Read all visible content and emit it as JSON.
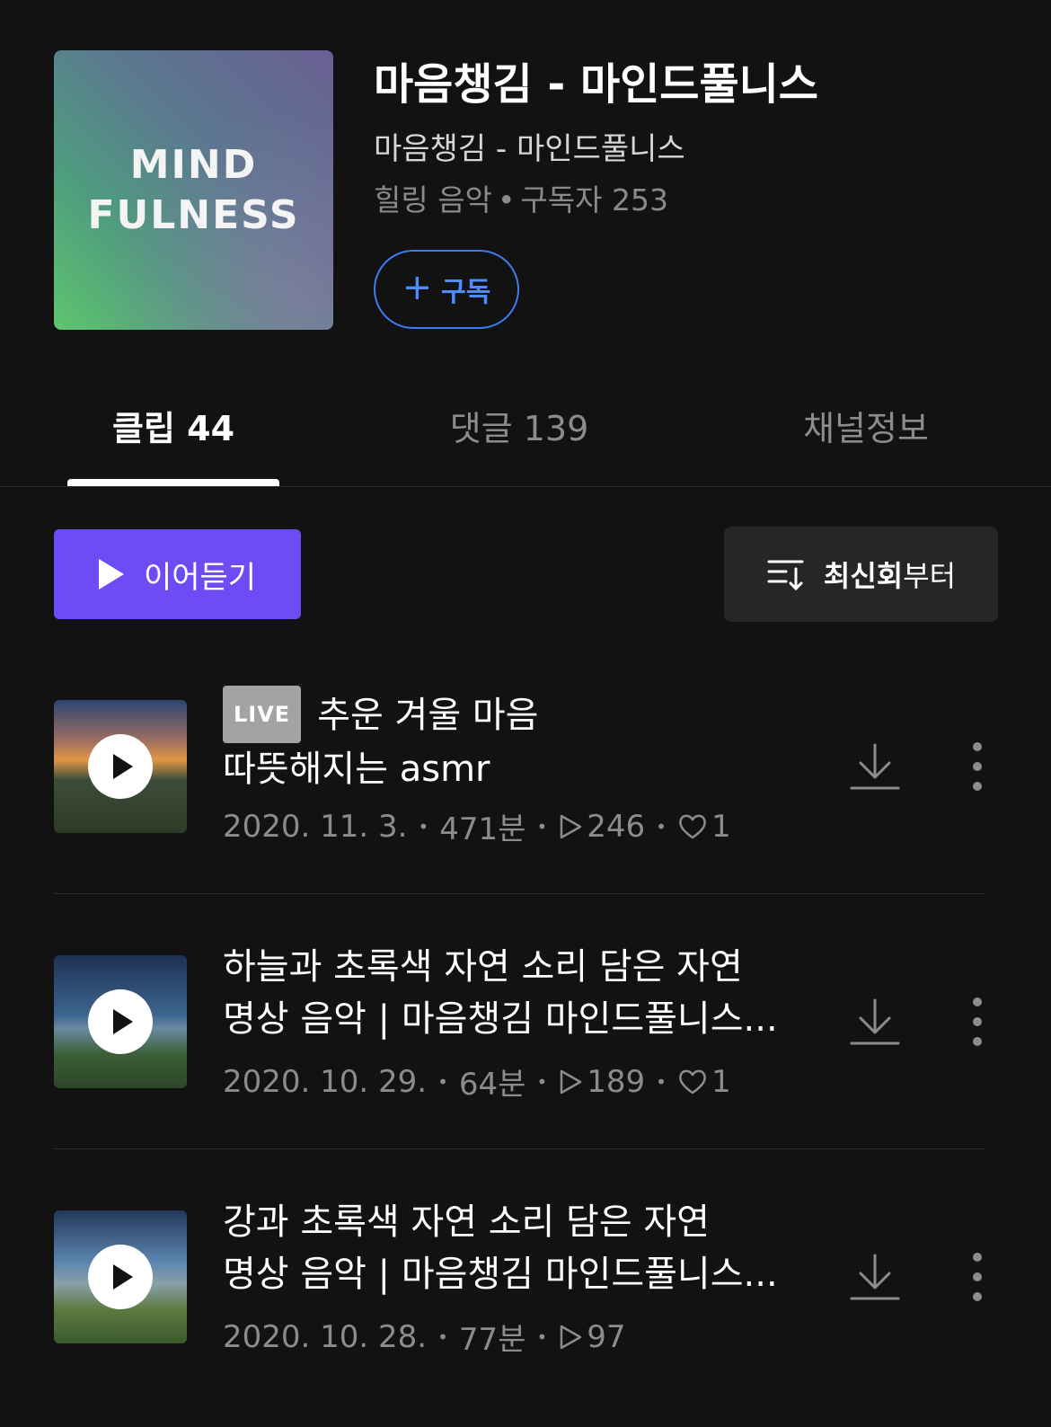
{
  "channel": {
    "cover_line1": "MIND",
    "cover_line2": "FULNESS",
    "title": "마음챙김 - 마인드풀니스",
    "subtitle": "마음챙김 - 마인드풀니스",
    "category": "힐링 음악",
    "subscribers": "구독자 253",
    "subscribe_label": "구독"
  },
  "tabs": [
    {
      "label": "클립 44",
      "active": true
    },
    {
      "label": "댓글 139",
      "active": false
    },
    {
      "label": "채널정보",
      "active": false
    }
  ],
  "controls": {
    "continue_label": "이어듣기",
    "sort_bold": "최신회",
    "sort_rest": "부터"
  },
  "clips": [
    {
      "live": "LIVE",
      "title_line1": "추운 겨울 마음",
      "title_line2": "따뜻해지는 asmr",
      "date": "2020. 11. 3.",
      "duration": "471분",
      "plays": "246",
      "likes": "1"
    },
    {
      "title_line1": "하늘과 초록색 자연 소리 담은 자연",
      "title_line2": "명상 음악 | 마음챙김 마인드풀니스...",
      "date": "2020. 10. 29.",
      "duration": "64분",
      "plays": "189",
      "likes": "1"
    },
    {
      "title_line1": "강과 초록색 자연 소리 담은 자연",
      "title_line2": "명상 음악 | 마음챙김 마인드풀니스...",
      "date": "2020. 10. 28.",
      "duration": "77분",
      "plays": "97"
    }
  ],
  "colors": {
    "background": "#121212",
    "accent_purple": "#6c4df5",
    "subscribe_blue": "#3d7cf0"
  },
  "icons": [
    "play-icon",
    "sort-icon",
    "plus-icon",
    "download-icon",
    "more-vertical-icon",
    "heart-icon",
    "play-count-icon"
  ]
}
